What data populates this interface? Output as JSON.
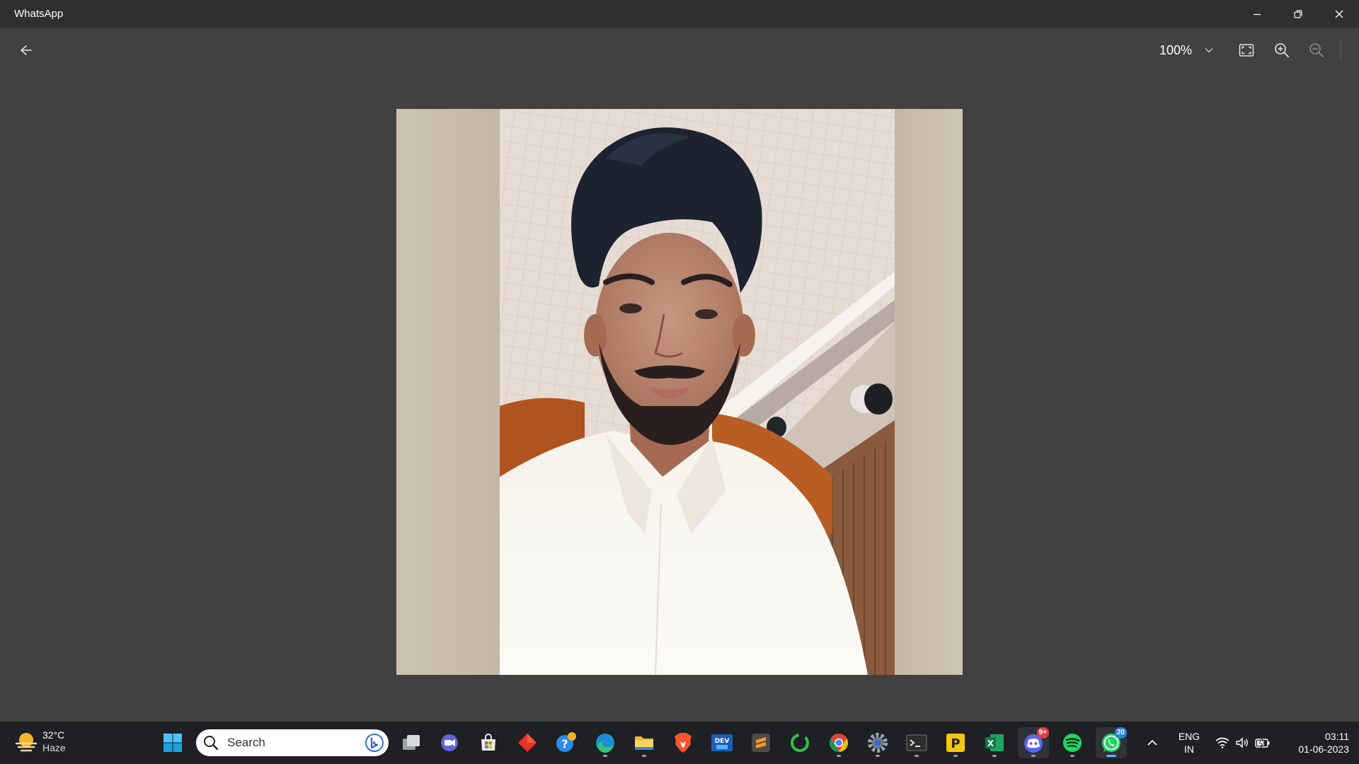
{
  "window": {
    "title": "WhatsApp"
  },
  "toolbar": {
    "zoom_level": "100%"
  },
  "photo": {
    "description_icon": "photo"
  },
  "taskbar": {
    "weather": {
      "temperature": "32°C",
      "condition": "Haze"
    },
    "search": {
      "placeholder": "Search"
    },
    "apps": [
      {
        "name": "start",
        "icon": "windows-logo-icon"
      },
      {
        "name": "task-view",
        "icon": "task-view-icon"
      },
      {
        "name": "teams-chat",
        "icon": "teams-icon"
      },
      {
        "name": "microsoft-store",
        "icon": "store-icon"
      },
      {
        "name": "git-app",
        "icon": "diamond-icon"
      },
      {
        "name": "get-help",
        "icon": "help-icon"
      },
      {
        "name": "edge",
        "icon": "edge-icon"
      },
      {
        "name": "file-explorer",
        "icon": "folder-icon"
      },
      {
        "name": "brave",
        "icon": "brave-icon"
      },
      {
        "name": "devtoys",
        "icon": "devtoys-icon"
      },
      {
        "name": "sublime-text",
        "icon": "sublime-icon"
      },
      {
        "name": "loader-app",
        "icon": "ring-icon"
      },
      {
        "name": "chrome",
        "icon": "chrome-icon"
      },
      {
        "name": "settings",
        "icon": "gear-icon"
      },
      {
        "name": "terminal",
        "icon": "terminal-icon"
      },
      {
        "name": "postman-p",
        "icon": "p-icon"
      },
      {
        "name": "excel",
        "icon": "excel-icon"
      },
      {
        "name": "discord",
        "icon": "discord-icon",
        "badge": "9+"
      },
      {
        "name": "spotify",
        "icon": "spotify-icon"
      },
      {
        "name": "whatsapp",
        "icon": "whatsapp-icon",
        "badge": "20"
      }
    ],
    "tray": {
      "language_line1": "ENG",
      "language_line2": "IN",
      "time": "03:11",
      "date": "01-06-2023"
    }
  },
  "colors": {
    "titlebar": "#2f2f2f",
    "viewer_bg": "#414141",
    "taskbar": "#1e2024",
    "accent": "#5bb8f5"
  }
}
